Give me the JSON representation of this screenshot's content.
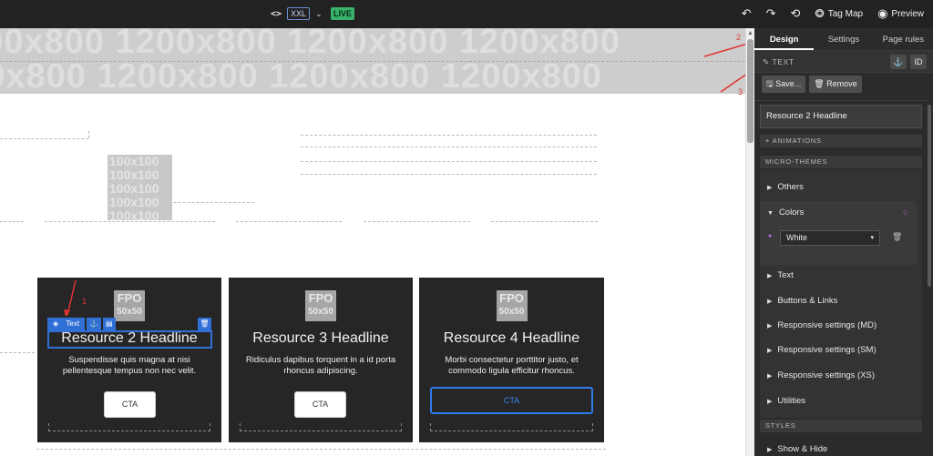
{
  "topbar": {
    "code_icon": "code-icon",
    "breakpoint": "XXL",
    "live_badge": "LIVE",
    "undo_icon": "undo-icon",
    "redo_icon": "redo-icon",
    "history_icon": "history-icon",
    "tag_map_label": "Tag Map",
    "preview_label": "Preview"
  },
  "canvas": {
    "hero_placeholder": "1200x800",
    "small_placeholder": "100x100",
    "fpo_label": "FPO",
    "fpo_size": "50x50",
    "cards": [
      {
        "title": "Resource 2 Headline",
        "body": "Suspendisse quis magna at nisi pellentesque tempus non nec velit.",
        "cta": "CTA"
      },
      {
        "title": "Resource 3 Headline",
        "body": "Ridiculus dapibus torquent in a id porta rhoncus adipiscing.",
        "cta": "CTA"
      },
      {
        "title": "Resource 4 Headline",
        "body": "Morbi consectetur porttitor justo, et commodo ligula efficitur rhoncus.",
        "cta": "CTA"
      }
    ],
    "selection_toolbar": {
      "label": "Text"
    },
    "annotations": {
      "a1": "1",
      "a2": "2",
      "a3": "3"
    }
  },
  "panel": {
    "tabs": [
      "Design",
      "Settings",
      "Page rules"
    ],
    "active_tab": "Design",
    "element_type": "TEXT",
    "save_label": "Save...",
    "remove_label": "Remove",
    "element_name": "Resource 2 Headline",
    "animations_label": "+ ANIMATIONS",
    "micro_themes_label": "MICRO-THEMES",
    "items": [
      "Others",
      "Colors",
      "Text",
      "Buttons & Links",
      "Responsive settings (MD)",
      "Responsive settings (SM)",
      "Responsive settings (XS)",
      "Utilities"
    ],
    "color_value": "White",
    "styles_label": "STYLES",
    "show_hide_label": "Show & Hide"
  },
  "colors": {
    "accent": "#2f6fd6",
    "live": "#38b26a",
    "panel_bg": "#2b2b2b",
    "topbar_bg": "#222222"
  }
}
